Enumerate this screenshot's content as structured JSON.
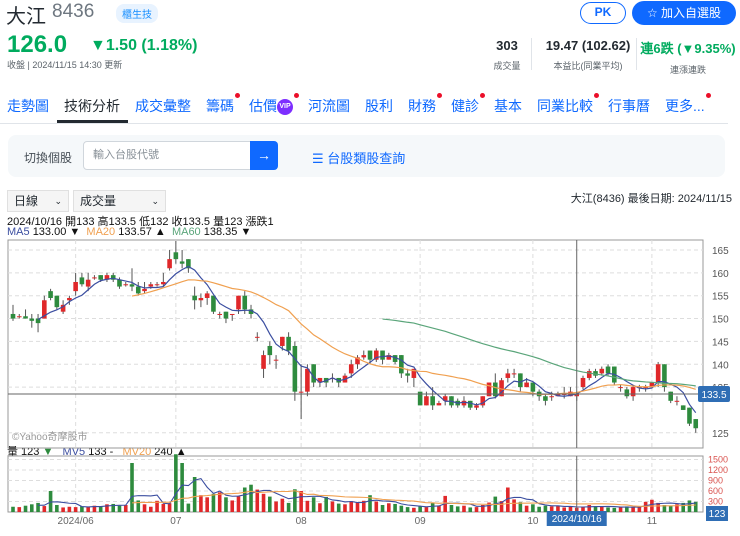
{
  "header": {
    "name": "大江",
    "code": "8436",
    "tag": "櫃生技",
    "pk_label": "PK",
    "add_label": "加入自選股",
    "price": "126.0",
    "change": "▼1.50 (1.18%)",
    "updated": "收盤 | 2024/11/15 14:30 更新",
    "stats": [
      {
        "value": "303",
        "label": "成交量"
      },
      {
        "value": "19.47 (102.62)",
        "label": "本益比(同業平均)"
      },
      {
        "value": "連6跌 (▼9.35%)",
        "label": "連漲連跌"
      }
    ]
  },
  "tabs": [
    {
      "label": "走勢圖",
      "dot": false
    },
    {
      "label": "技術分析",
      "dot": false,
      "active": true
    },
    {
      "label": "成交彙整",
      "dot": false
    },
    {
      "label": "籌碼",
      "dot": true
    },
    {
      "label": "估價",
      "dot": true,
      "vip": "VIP"
    },
    {
      "label": "河流圖",
      "dot": false
    },
    {
      "label": "股利",
      "dot": false
    },
    {
      "label": "財務",
      "dot": true
    },
    {
      "label": "健診",
      "dot": true
    },
    {
      "label": "基本",
      "dot": false
    },
    {
      "label": "同業比較",
      "dot": true
    },
    {
      "label": "行事曆",
      "dot": false
    },
    {
      "label": "更多...",
      "dot": true
    }
  ],
  "search": {
    "label": "切換個股",
    "placeholder": "輸入台股代號",
    "button": "→",
    "link": "☰ 台股類股查詢"
  },
  "controls": {
    "period": "日線",
    "indicator": "成交量",
    "last_date": "大江(8436)   最後日期: 2024/11/15"
  },
  "info": {
    "ohlc": "2024/10/16 開133 高133.5 低132 收133.5 量123 漲跌1",
    "ma5_label": "MA5",
    "ma5": "133.00 ▼",
    "ma20_label": "MA20",
    "ma20": "133.57 ▲",
    "ma60_label": "MA60",
    "ma60": "138.35 ▼",
    "vol_label": "量 123",
    "vol_arrow": "▼",
    "mv5_label": "MV5",
    "mv5": "133 -",
    "mv20_label": "MV20",
    "mv20": "240 ▲"
  },
  "colors": {
    "up": "#e0282a",
    "down": "#2e8b3e",
    "ma5": "#3b4ea0",
    "ma20": "#f0a050",
    "ma60": "#5aa57a",
    "accent": "#0f69ff",
    "price_green": "#00ab5e"
  },
  "chart_data": {
    "type": "candlestick",
    "watermark": "©Yahoo奇摩股市",
    "y_ticks": [
      165,
      160,
      155,
      150,
      145,
      140,
      135,
      125
    ],
    "ylim": [
      122.5,
      167
    ],
    "vol_ticks": [
      1500,
      1200,
      900,
      600,
      300
    ],
    "x_labels": [
      {
        "label": "2024/06",
        "index": 10
      },
      {
        "label": "07",
        "index": 26
      },
      {
        "label": "08",
        "index": 46
      },
      {
        "label": "09",
        "index": 65
      },
      {
        "label": "10",
        "index": 83
      },
      {
        "label": "11",
        "index": 102
      }
    ],
    "crosshair": {
      "index": 90,
      "price_label": "133.5",
      "date_label": "2024/10/16",
      "vol_label": "123"
    },
    "ohlc": [
      [
        151,
        153,
        149.5,
        150
      ],
      [
        150.5,
        151,
        150,
        150.5
      ],
      [
        150.5,
        152,
        150,
        150
      ],
      [
        150,
        151,
        148,
        149.5
      ],
      [
        150,
        151,
        147,
        149
      ],
      [
        150,
        155,
        150,
        154
      ],
      [
        156,
        156.5,
        154,
        154.5
      ],
      [
        155,
        155,
        152,
        152.5
      ],
      [
        151.5,
        154,
        151,
        153
      ],
      [
        154,
        155,
        153,
        154.5
      ],
      [
        156,
        160,
        155,
        158
      ],
      [
        159,
        160,
        157,
        157.5
      ],
      [
        157,
        160,
        156,
        158.5
      ],
      [
        159,
        159.5,
        158.5,
        159
      ],
      [
        159.5,
        159.5,
        158,
        158.5
      ],
      [
        158.5,
        160,
        158,
        159.5
      ],
      [
        159.5,
        160,
        158,
        158.5
      ],
      [
        158.5,
        159,
        156.5,
        157
      ],
      [
        157.5,
        158,
        157,
        157.5
      ],
      [
        157.5,
        161,
        156,
        157
      ],
      [
        157,
        158,
        155,
        155.5
      ],
      [
        156,
        158,
        155.5,
        156.5
      ],
      [
        157,
        158,
        156.5,
        157.5
      ],
      [
        157.5,
        158,
        157,
        157.5
      ],
      [
        157.5,
        160,
        157,
        158
      ],
      [
        161,
        165,
        160.5,
        163
      ],
      [
        164.5,
        167,
        162,
        163
      ],
      [
        162.5,
        165,
        161,
        162
      ],
      [
        163,
        163,
        160,
        161
      ],
      [
        155,
        157,
        152,
        154
      ],
      [
        154,
        155.5,
        152.5,
        154.5
      ],
      [
        154.5,
        156,
        153,
        155.5
      ],
      [
        155,
        155,
        151,
        151.5
      ],
      [
        151,
        151.5,
        150,
        151
      ],
      [
        151.5,
        151.5,
        149,
        150
      ],
      [
        151,
        151,
        149.5,
        151
      ],
      [
        152,
        155,
        151,
        155
      ],
      [
        155,
        156,
        151,
        152
      ],
      [
        152,
        153,
        150,
        151
      ],
      [
        146,
        147,
        145,
        146
      ],
      [
        139,
        143,
        137,
        142
      ],
      [
        144,
        145,
        140,
        142
      ],
      [
        141,
        142,
        139,
        141
      ],
      [
        144,
        146,
        143,
        146
      ],
      [
        146,
        147,
        142,
        143
      ],
      [
        144,
        145,
        132,
        134
      ],
      [
        134,
        140,
        128,
        134
      ],
      [
        134,
        140,
        133,
        139
      ],
      [
        140,
        140,
        135,
        136
      ],
      [
        136,
        137,
        135,
        137
      ],
      [
        137,
        137,
        135,
        136
      ],
      [
        137,
        138,
        136,
        137
      ],
      [
        137,
        137,
        135,
        136
      ],
      [
        136,
        138,
        136,
        137.5
      ],
      [
        138,
        141,
        137,
        140
      ],
      [
        140,
        142,
        139,
        141.5
      ],
      [
        141.5,
        143,
        141,
        142
      ],
      [
        143,
        143,
        140,
        141
      ],
      [
        141,
        143.5,
        140.5,
        143
      ],
      [
        143,
        143,
        140,
        141
      ],
      [
        141,
        142.5,
        141,
        142
      ],
      [
        142,
        142,
        140,
        140.5
      ],
      [
        142,
        142,
        137,
        138
      ],
      [
        138,
        139,
        136,
        137.5
      ],
      [
        137,
        139,
        135,
        139
      ],
      [
        134,
        134,
        131,
        131
      ],
      [
        131,
        134,
        131,
        133
      ],
      [
        133,
        135,
        130,
        131
      ],
      [
        131,
        132,
        131,
        131.5
      ],
      [
        132,
        133.5,
        131,
        133
      ],
      [
        133,
        133,
        130.5,
        131
      ],
      [
        132,
        132.5,
        130.5,
        131
      ],
      [
        131,
        133,
        130.5,
        132
      ],
      [
        132,
        132,
        130,
        130.5
      ],
      [
        130.5,
        131.5,
        130,
        131
      ],
      [
        131,
        133,
        130.5,
        133
      ],
      [
        133,
        136,
        133,
        136
      ],
      [
        136,
        138,
        132.5,
        133
      ],
      [
        133,
        137,
        133,
        136.5
      ],
      [
        137,
        139,
        136,
        138
      ],
      [
        138,
        139,
        137,
        138
      ],
      [
        138,
        138,
        134,
        135
      ],
      [
        135,
        137,
        135,
        136
      ],
      [
        136,
        136,
        133,
        134
      ],
      [
        134,
        134.5,
        132,
        133
      ],
      [
        133,
        133.5,
        131,
        132
      ],
      [
        133,
        134,
        132,
        133
      ],
      [
        133,
        134,
        133,
        133.5
      ],
      [
        133.5,
        135,
        132.5,
        133.5
      ],
      [
        133,
        135,
        133,
        134
      ],
      [
        133,
        134,
        132,
        133.5
      ],
      [
        135,
        137.5,
        134.5,
        137
      ],
      [
        137,
        139,
        136.5,
        138.5
      ],
      [
        138.5,
        139,
        137,
        137.5
      ],
      [
        138,
        139.5,
        137.5,
        139
      ],
      [
        139.5,
        140,
        137.5,
        138
      ],
      [
        139.5,
        139.5,
        135.5,
        136
      ],
      [
        135,
        135.5,
        134,
        135
      ],
      [
        134.5,
        135,
        132.5,
        133
      ],
      [
        133,
        135.5,
        132,
        135
      ],
      [
        135,
        135.5,
        134,
        135
      ],
      [
        135,
        135.5,
        134,
        135
      ],
      [
        135,
        136,
        135,
        136
      ],
      [
        136,
        140.5,
        135,
        140
      ],
      [
        140,
        140,
        134,
        135
      ],
      [
        134,
        134,
        131.5,
        132
      ],
      [
        132,
        133,
        131,
        132
      ],
      [
        131,
        131,
        130,
        130
      ],
      [
        130.5,
        130.5,
        126.5,
        127
      ],
      [
        128,
        128,
        125,
        126
      ]
    ],
    "volume": [
      150,
      140,
      180,
      220,
      260,
      170,
      600,
      200,
      130,
      150,
      140,
      160,
      150,
      180,
      150,
      220,
      230,
      180,
      200,
      1400,
      330,
      220,
      150,
      320,
      230,
      250,
      1650,
      1400,
      240,
      1000,
      480,
      420,
      520,
      560,
      420,
      330,
      450,
      700,
      780,
      640,
      520,
      440,
      300,
      380,
      260,
      650,
      600,
      320,
      420,
      250,
      430,
      300,
      240,
      220,
      310,
      280,
      320,
      480,
      300,
      200,
      250,
      230,
      180,
      140,
      120,
      160,
      140,
      260,
      180,
      460,
      200,
      160,
      180,
      130,
      140,
      200,
      270,
      440,
      310,
      700,
      360,
      280,
      180,
      220,
      150,
      180,
      160,
      170,
      130,
      150,
      123,
      140,
      200,
      170,
      150,
      130,
      120,
      140,
      160,
      140,
      150,
      290,
      350,
      260,
      200,
      180,
      220,
      260,
      330,
      290
    ]
  }
}
